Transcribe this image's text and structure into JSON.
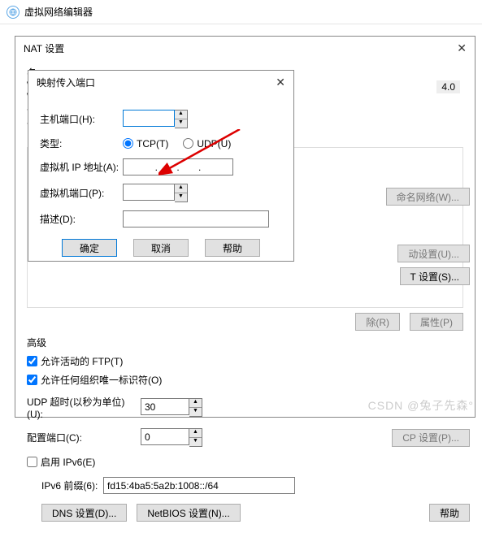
{
  "app_title": "虚拟网络编辑器",
  "nat": {
    "title": "NAT 设置",
    "net_label": "网络:",
    "net_partial": "vmnet",
    "sub_ip_tail": "4.0",
    "tip": "已",
    "advanced": "高级",
    "allow_ftp": "允许活动的 FTP(T)",
    "allow_org": "允许任何组织唯一标识符(O)",
    "udp_timeout": "UDP 超时(以秒为单位)(U):",
    "udp_value": "30",
    "cfg_port": "配置端口(C):",
    "cfg_value": "0",
    "enable_ipv6": "启用 IPv6(E)",
    "ipv6_prefix": "IPv6 前缀(6):",
    "ipv6_value": "fd15:4ba5:5a2b:1008::/64",
    "dns_btn": "DNS 设置(D)...",
    "netbios_btn": "NetBIOS 设置(N)...",
    "rename_net": "命名网络(W)...",
    "remove_btn": "除(R)",
    "props_btn": "属性(P)",
    "auto_btn": "动设置(U)...",
    "nat_settings_btn": "T 设置(S)...",
    "cp_btn": "CP 设置(P)...",
    "help_btn": "帮助"
  },
  "map": {
    "title": "映射传入端口",
    "host_port": "主机端口(H):",
    "type": "类型:",
    "tcp": "TCP(T)",
    "udp": "UDP(U)",
    "vm_ip": "虚拟机 IP 地址(A):",
    "vm_port": "虚拟机端口(P):",
    "desc": "描述(D):",
    "ok": "确定",
    "cancel": "取消",
    "help": "帮助",
    "ip_dots": ".       .       ."
  },
  "watermark": "CSDN @兔子先森°"
}
